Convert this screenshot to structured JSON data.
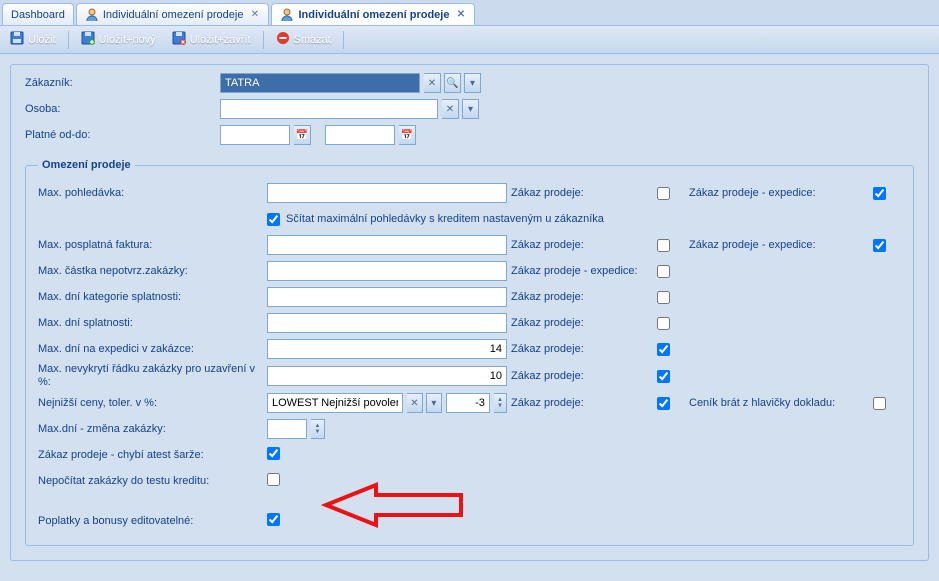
{
  "tabs": {
    "dashboard": {
      "label": "Dashboard"
    },
    "list": {
      "label": "Individuální omezení prodeje"
    },
    "detail": {
      "label": "Individuální omezení prodeje"
    }
  },
  "toolbar": {
    "save": "Uložit",
    "saveNew": "Uložit+nový",
    "saveClose": "Uložit+zavřít",
    "delete": "Smazat"
  },
  "header": {
    "customerLabel": "Zákazník:",
    "customerValue": "TATRA",
    "personLabel": "Osoba:",
    "personValue": "",
    "validLabel": "Platné od-do:",
    "validFrom": "",
    "validTo": ""
  },
  "group": {
    "title": "Omezení prodeje",
    "rows": {
      "maxReceivable": {
        "label": "Max. pohledávka:",
        "value": "",
        "zpLabel": "Zákaz prodeje:",
        "zp": false,
        "zpeLabel": "Zákaz prodeje - expedice:",
        "zpe": true
      },
      "sumCredit": {
        "label": "Sčítat maximální pohledávky s kreditem nastaveným u zákazníka",
        "checked": true
      },
      "maxOverdue": {
        "label": "Max. posplatná faktura:",
        "value": "",
        "zpLabel": "Zákaz prodeje:",
        "zp": false,
        "zpeLabel": "Zákaz prodeje - expedice:",
        "zpe": true
      },
      "maxUnconfirmed": {
        "label": "Max. částka nepotvrz.zakázky:",
        "value": "",
        "zpeLabel": "Zákaz prodeje - expedice:",
        "zpe": false
      },
      "maxDueCategoryDays": {
        "label": "Max. dní kategorie splatnosti:",
        "value": "",
        "zpLabel": "Zákaz prodeje:",
        "zp": false
      },
      "maxDueDays": {
        "label": "Max. dní splatnosti:",
        "value": "",
        "zpLabel": "Zákaz prodeje:",
        "zp": false
      },
      "maxDaysExped": {
        "label": "Max. dní na expedici v zakázce:",
        "value": "14",
        "zpLabel": "Zákaz prodeje:",
        "zp": true
      },
      "maxUncovered": {
        "label": "Max. nevykrytí řádku zakázky pro uzavření v %:",
        "value": "10",
        "zpLabel": "Zákaz prodeje:",
        "zp": true
      },
      "lowestPrices": {
        "label": "Nejnižší ceny, toler. v %:",
        "comboValue": "LOWEST Nejnižší povoler",
        "tolValue": "-3",
        "zpLabel": "Zákaz prodeje:",
        "zp": true,
        "plHeadLabel": "Ceník brát z hlavičky dokladu:",
        "plHead": false
      },
      "maxDaysOrderChange": {
        "label": "Max.dní - změna zakázky:",
        "value": ""
      },
      "banMissingAttest": {
        "label": "Zákaz prodeje - chybí atest šarže:",
        "checked": true
      },
      "excludeCreditTest": {
        "label": "Nepočítat zakázky do testu kreditu:",
        "checked": false
      },
      "feesBonusEditable": {
        "label": "Poplatky a bonusy editovatelné:",
        "checked": true
      }
    }
  }
}
